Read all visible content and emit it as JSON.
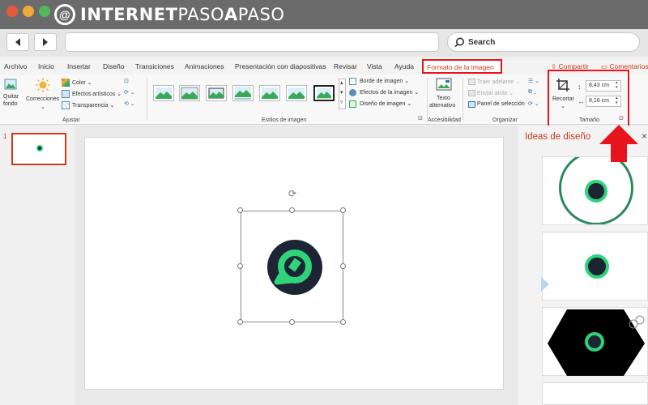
{
  "window": {
    "dots": [
      "#e9573f",
      "#f0a93b",
      "#54b85a"
    ]
  },
  "logo": {
    "part1": "INTERNET",
    "part2": "PASO",
    "part3": "A",
    "part4": "PASO"
  },
  "browser": {
    "back_icon": "arrow-left",
    "forward_icon": "arrow-right",
    "search_placeholder": "Search"
  },
  "menu": {
    "items": [
      "Archivo",
      "Inicio",
      "Insertar",
      "Diseño",
      "Transiciones",
      "Animaciones",
      "Presentación con diapositivas",
      "Revisar",
      "Vista",
      "Ayuda"
    ],
    "active_tab": "Formato de la imagen",
    "share": "Compartir",
    "comments": "Comentarios"
  },
  "ribbon": {
    "remove_bg_1": "Quitar",
    "remove_bg_2": "fondo",
    "corrections": "Correcciones",
    "color": "Color",
    "artistic": "Efectos artísticos",
    "transparency": "Transparencia",
    "group_adjust": "Ajustar",
    "border": "Borde de imagen",
    "effects": "Efectos de la imagen",
    "layout": "Diseño de imagen",
    "group_styles": "Estilos de imagen",
    "alt_text_1": "Texto",
    "alt_text_2": "alternativo",
    "group_access": "Accesibilidad",
    "bring_forward": "Traer adelante",
    "send_back": "Enviar atrás",
    "selection_pane": "Panel de selección",
    "group_arrange": "Organizar",
    "crop": "Recortar",
    "height": "8,43 cm",
    "width": "8,16 cm",
    "group_size": "Tamaño"
  },
  "slides": {
    "number": "1"
  },
  "ideas": {
    "title": "Ideas de diseño",
    "close": "×"
  },
  "colors": {
    "accent_red": "#e8141c",
    "brand_green": "#2fd37a",
    "logo_dark": "#1d2433",
    "powerpoint_orange": "#c43e1c"
  }
}
